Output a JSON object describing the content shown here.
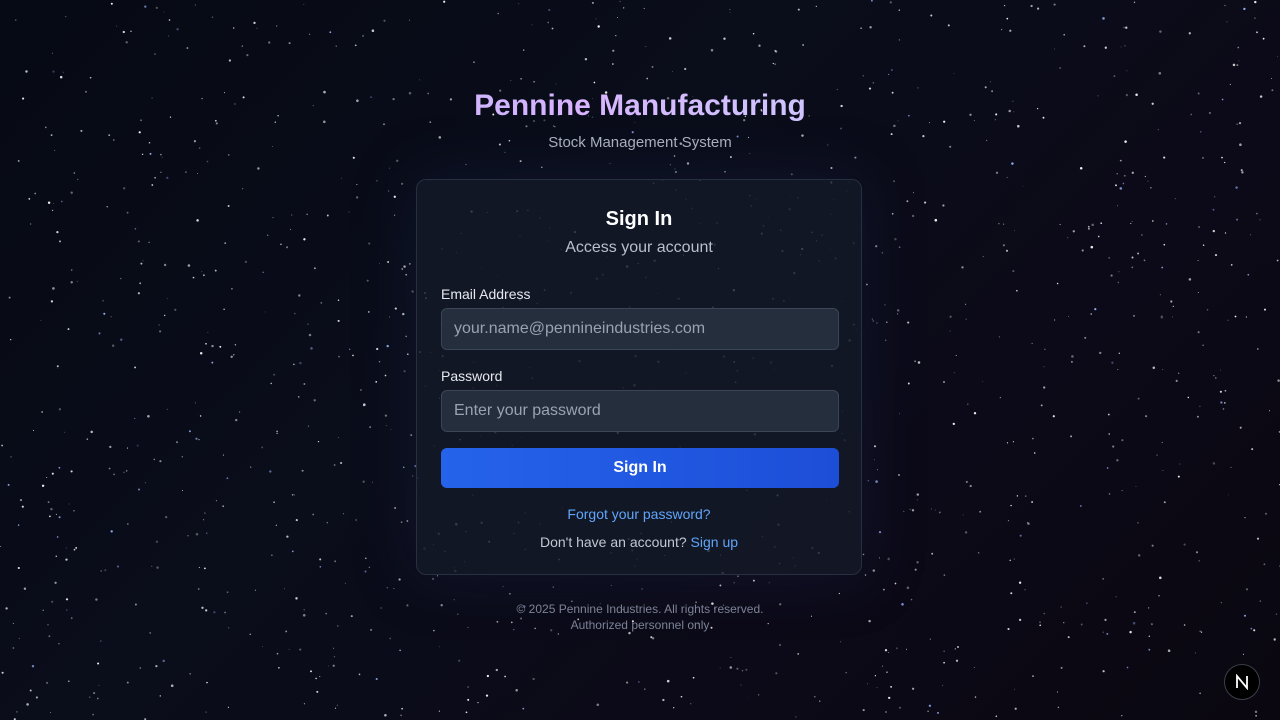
{
  "brand": {
    "title": "Pennine Manufacturing",
    "subtitle": "Stock Management System"
  },
  "login_card": {
    "title": "Sign In",
    "subtitle": "Access your account",
    "email": {
      "label": "Email Address",
      "value": "",
      "placeholder": "your.name@pennineindustries.com"
    },
    "password": {
      "label": "Password",
      "value": "",
      "placeholder": "Enter your password"
    },
    "submit_label": "Sign In",
    "forgot_password_label": "Forgot your password?",
    "signup_prompt": "Don't have an account?",
    "signup_label": "Sign up"
  },
  "footer": {
    "copyright": "© 2025 Pennine Industries. All rights reserved.",
    "note": "Authorized personnel only"
  },
  "devtools": {
    "icon": "nextjs-logo-icon",
    "glyph": "N"
  },
  "colors": {
    "accent": "#2563eb",
    "link": "#60a5fa",
    "background": "#080b16",
    "card": "#141a28"
  }
}
